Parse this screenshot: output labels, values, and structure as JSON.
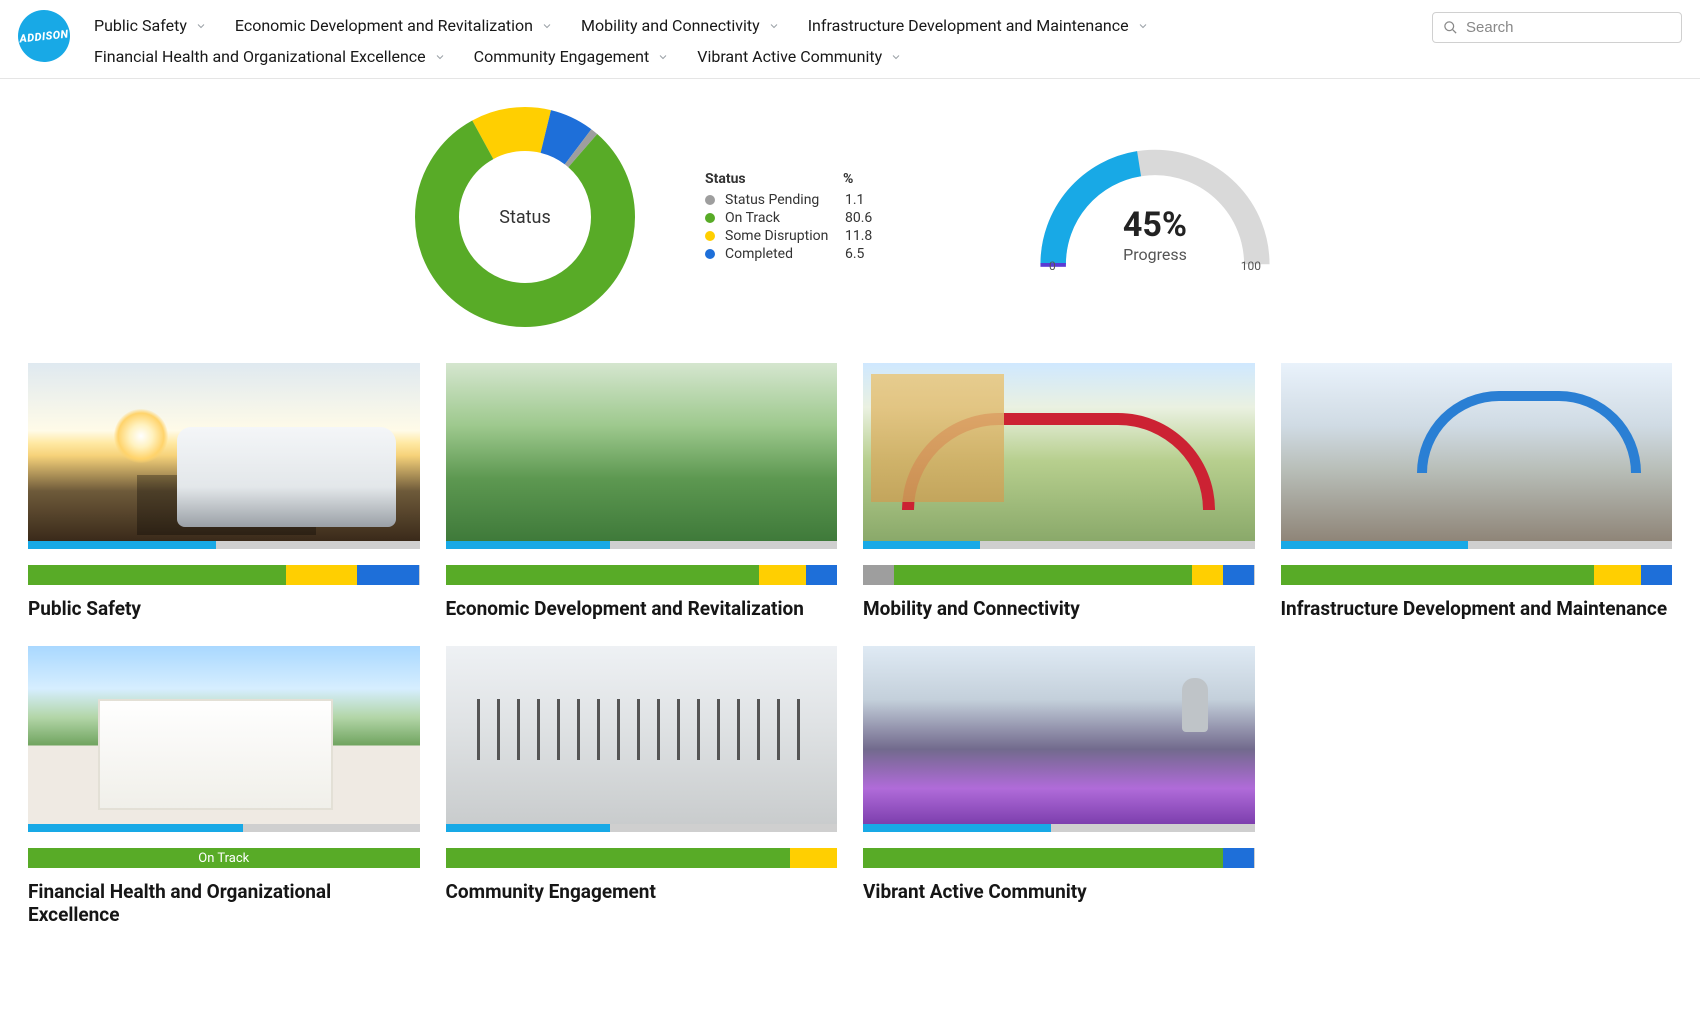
{
  "brand": "ADDISON",
  "nav": [
    "Public Safety",
    "Economic Development and Revitalization",
    "Mobility and Connectivity",
    "Infrastructure Development and Maintenance",
    "Financial Health and Organizational Excellence",
    "Community Engagement",
    "Vibrant Active Community"
  ],
  "search": {
    "placeholder": "Search"
  },
  "colors": {
    "pending": "#9e9e9e",
    "ontrack": "#58ab27",
    "disruption": "#ffcf01",
    "completed": "#1e6fd9",
    "progress": "#18a9e6",
    "progressTrack": "#d9d9d9"
  },
  "chart_data": [
    {
      "type": "pie",
      "title": "Status",
      "legend_headers": {
        "status": "Status",
        "pct": "%"
      },
      "series": [
        {
          "name": "Status Pending",
          "value": 1.1,
          "color": "#9e9e9e"
        },
        {
          "name": "On Track",
          "value": 80.6,
          "color": "#58ab27"
        },
        {
          "name": "Some Disruption",
          "value": 11.8,
          "color": "#ffcf01"
        },
        {
          "name": "Completed",
          "value": 6.5,
          "color": "#1e6fd9"
        }
      ]
    },
    {
      "type": "gauge",
      "title": "Progress",
      "value": 45,
      "display": "45%",
      "min": 0,
      "max": 100,
      "min_label": "0",
      "max_label": "100"
    }
  ],
  "cards": [
    {
      "title": "Public Safety",
      "progress_pct": 48,
      "status_segments": [
        {
          "kind": "ontrack",
          "pct": 66
        },
        {
          "kind": "disruption",
          "pct": 18
        },
        {
          "kind": "completed",
          "pct": 16
        }
      ]
    },
    {
      "title": "Economic Development and Revitalization",
      "progress_pct": 42,
      "status_segments": [
        {
          "kind": "ontrack",
          "pct": 80
        },
        {
          "kind": "disruption",
          "pct": 12
        },
        {
          "kind": "completed",
          "pct": 8
        }
      ]
    },
    {
      "title": "Mobility and Connectivity",
      "progress_pct": 30,
      "status_segments": [
        {
          "kind": "pending",
          "pct": 8
        },
        {
          "kind": "ontrack",
          "pct": 76
        },
        {
          "kind": "disruption",
          "pct": 8
        },
        {
          "kind": "completed",
          "pct": 8
        }
      ]
    },
    {
      "title": "Infrastructure Development and Maintenance",
      "progress_pct": 48,
      "status_segments": [
        {
          "kind": "ontrack",
          "pct": 80
        },
        {
          "kind": "disruption",
          "pct": 12
        },
        {
          "kind": "completed",
          "pct": 8
        }
      ]
    },
    {
      "title": "Financial Health and Organizational Excellence",
      "progress_pct": 55,
      "status_label": "On Track",
      "status_segments": [
        {
          "kind": "ontrack",
          "pct": 100
        }
      ]
    },
    {
      "title": "Community Engagement",
      "progress_pct": 42,
      "status_segments": [
        {
          "kind": "ontrack",
          "pct": 88
        },
        {
          "kind": "disruption",
          "pct": 12
        }
      ]
    },
    {
      "title": "Vibrant Active Community",
      "progress_pct": 48,
      "status_segments": [
        {
          "kind": "ontrack",
          "pct": 92
        },
        {
          "kind": "completed",
          "pct": 8
        }
      ]
    }
  ]
}
